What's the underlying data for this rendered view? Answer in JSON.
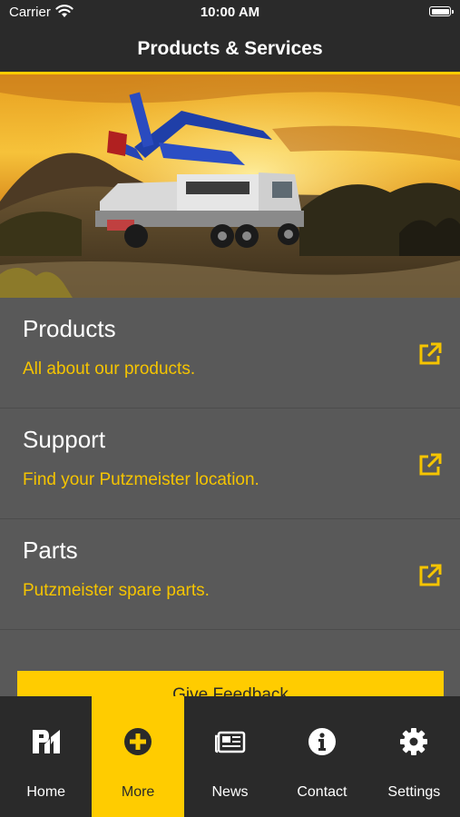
{
  "status_bar": {
    "carrier": "Carrier",
    "time": "10:00 AM"
  },
  "nav": {
    "title": "Products & Services"
  },
  "menu": [
    {
      "title": "Products",
      "subtitle": "All about our products."
    },
    {
      "title": "Support",
      "subtitle": "Find your Putzmeister location."
    },
    {
      "title": "Parts",
      "subtitle": "Putzmeister spare parts."
    }
  ],
  "feedback": {
    "label": "Give Feedback"
  },
  "tabs": [
    {
      "label": "Home",
      "icon": "putzmeister-logo-icon"
    },
    {
      "label": "More",
      "icon": "plus-circle-icon",
      "active": true
    },
    {
      "label": "News",
      "icon": "newspaper-icon"
    },
    {
      "label": "Contact",
      "icon": "info-circle-icon"
    },
    {
      "label": "Settings",
      "icon": "gear-icon"
    }
  ],
  "colors": {
    "accent": "#ffcc00",
    "bar": "#2a2a2a",
    "panel": "#595959",
    "subtitle": "#f5c400"
  }
}
